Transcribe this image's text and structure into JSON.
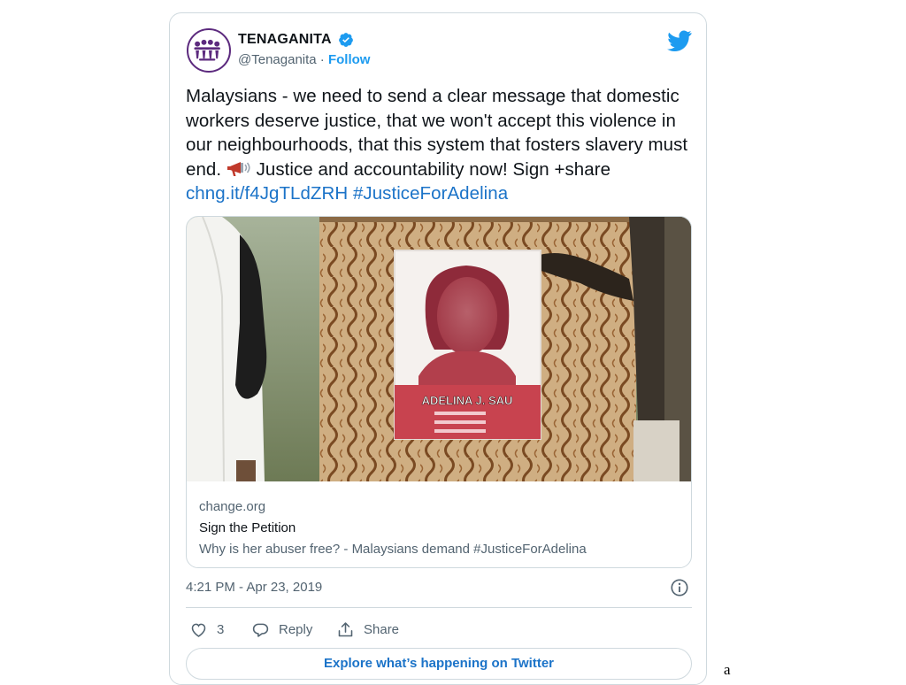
{
  "account": {
    "display_name": "TENAGANITA",
    "handle": "@Tenaganita",
    "separator": "·",
    "follow_label": "Follow",
    "verified": true
  },
  "tweet": {
    "text_before_emoji": "Malaysians - we need to send a clear message that domestic workers deserve justice, that we won't accept this violence in our neighbourhoods, that this system that fosters slavery must end.",
    "text_after_emoji": " Justice and accountability now! Sign +share ",
    "link_text": "chng.it/f4JgTLdZRH",
    "hashtag": "#JusticeForAdelina",
    "timestamp": "4:21 PM - Apr 23, 2019"
  },
  "media_card": {
    "poster_name": "ADELINA J. SAU",
    "domain": "change.org",
    "title": "Sign the Petition",
    "description": "Why is her abuser free? - Malaysians demand #JusticeForAdelina"
  },
  "actions": {
    "like_count": "3",
    "reply_label": "Reply",
    "share_label": "Share"
  },
  "explore_label": "Explore what’s happening on Twitter",
  "stray_text": "a",
  "colors": {
    "link": "#1b73c8",
    "twitter_blue": "#1d9bf0",
    "brand_purple": "#5c2a7e",
    "border": "#cfd9de",
    "muted_text": "#536471"
  },
  "icons": [
    "avatar-logo",
    "verified-badge-icon",
    "twitter-bird-icon",
    "megaphone-icon",
    "info-icon",
    "heart-icon",
    "reply-icon",
    "share-icon"
  ]
}
